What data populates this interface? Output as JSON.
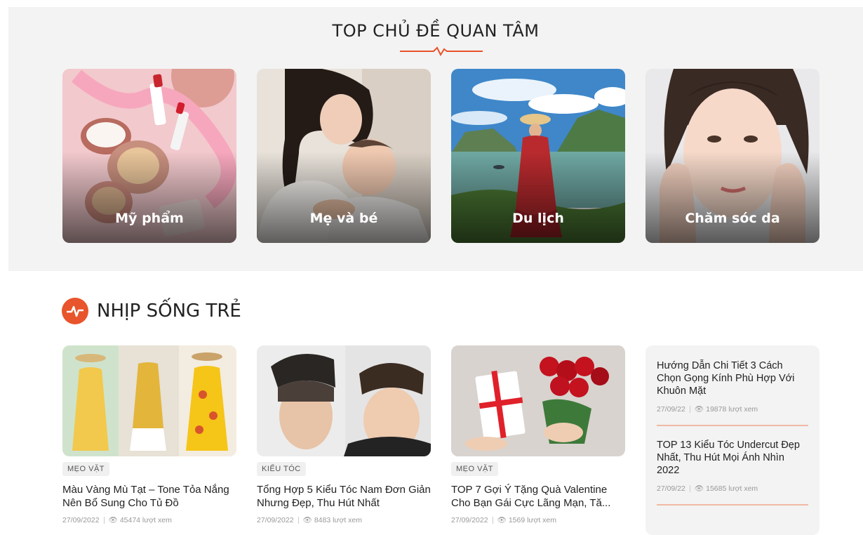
{
  "top_topics": {
    "title": "TOP CHỦ ĐỀ QUAN TÂM",
    "accent_color": "#e8542b",
    "cards": [
      {
        "label": "Mỹ phẩm"
      },
      {
        "label": "Mẹ và bé"
      },
      {
        "label": "Du lịch"
      },
      {
        "label": "Chăm sóc da"
      }
    ]
  },
  "section": {
    "title": "NHỊP SỐNG TRẺ",
    "icon": "pulse-icon"
  },
  "posts": [
    {
      "tag": "MẸO VẶT",
      "title": "Màu Vàng Mù Tạt – Tone Tỏa Nắng Nên Bổ Sung Cho Tủ Đồ",
      "date": "27/09/2022",
      "views": "45474 lượt xem"
    },
    {
      "tag": "KIỂU TÓC",
      "title": "Tổng Hợp 5 Kiểu Tóc Nam Đơn Giản Nhưng Đẹp, Thu Hút Nhất",
      "date": "27/09/2022",
      "views": "8483 lượt xem"
    },
    {
      "tag": "MẸO VẶT",
      "title": "TOP 7 Gợi Ý Tặng Quà Valentine Cho Bạn Gái Cực Lãng Mạn, Tă...",
      "date": "27/09/2022",
      "views": "1569 lượt xem"
    }
  ],
  "sidebar": [
    {
      "title": "Hướng Dẫn Chi Tiết 3 Cách Chọn Gọng Kính Phù Hợp Với Khuôn Mặt",
      "date": "27/09/22",
      "views": "19878 lượt xem"
    },
    {
      "title": "TOP 13 Kiểu Tóc Undercut Đẹp Nhất, Thu Hút Mọi Ánh Nhìn 2022",
      "date": "27/09/22",
      "views": "15685 lượt xem"
    }
  ]
}
